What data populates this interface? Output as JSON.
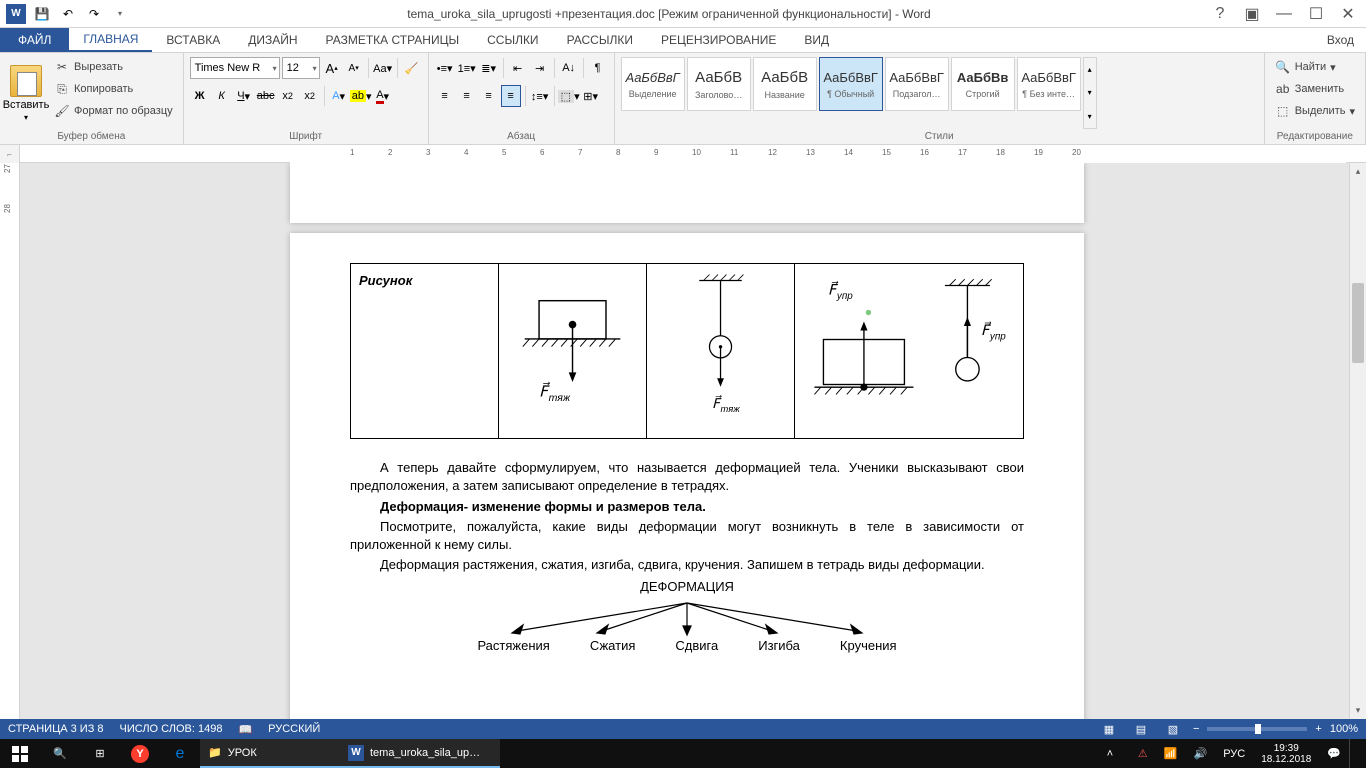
{
  "titlebar": {
    "title": "tema_uroka_sila_uprugosti +презентация.doc [Режим ограниченной функциональности] - Word"
  },
  "tabs": {
    "file": "ФАЙЛ",
    "items": [
      "ГЛАВНАЯ",
      "ВСТАВКА",
      "ДИЗАЙН",
      "РАЗМЕТКА СТРАНИЦЫ",
      "ССЫЛКИ",
      "РАССЫЛКИ",
      "РЕЦЕНЗИРОВАНИЕ",
      "ВИД"
    ],
    "login": "Вход"
  },
  "ribbon": {
    "clipboard": {
      "label": "Буфер обмена",
      "paste": "Вставить",
      "cut": "Вырезать",
      "copy": "Копировать",
      "format": "Формат по образцу"
    },
    "font": {
      "label": "Шрифт",
      "name": "Times New R",
      "size": "12"
    },
    "paragraph": {
      "label": "Абзац"
    },
    "styles": {
      "label": "Стили",
      "items": [
        {
          "preview": "АаБбВвГ",
          "name": "Выделение",
          "italic": true
        },
        {
          "preview": "АаБбВ",
          "name": "Заголово…"
        },
        {
          "preview": "АаБбВ",
          "name": "Название"
        },
        {
          "preview": "АаБбВвГ",
          "name": "¶ Обычный"
        },
        {
          "preview": "АаБбВвГ",
          "name": "Подзагол…"
        },
        {
          "preview": "АаБбВв",
          "name": "Строгий",
          "bold": true
        },
        {
          "preview": "АаБбВвГ",
          "name": "¶ Без инте…"
        }
      ]
    },
    "editing": {
      "label": "Редактирование",
      "find": "Найти",
      "replace": "Заменить",
      "select": "Выделить"
    }
  },
  "ruler": {
    "hticks": [
      "1",
      "2",
      "3",
      "4",
      "5",
      "6",
      "7",
      "8",
      "9",
      "10",
      "11",
      "12",
      "13",
      "14",
      "15",
      "16",
      "17",
      "18",
      "19",
      "20"
    ]
  },
  "vruler": {
    "ticks": [
      "27",
      "28"
    ]
  },
  "document": {
    "figureLabel": "Рисунок",
    "forceGrav": "тяж",
    "forceElastic": "упр",
    "p1": "А теперь давайте сформулируем, что называется деформацией тела. Ученики высказывают свои предположения, а затем записывают определение в тетрадях.",
    "p2": "Деформация- изменение формы и размеров тела.",
    "p3": "Посмотрите, пожалуйста, какие виды деформации могут возникнуть в теле в зависимости от приложенной к нему силы.",
    "p4": "Деформация растяжения, сжатия, изгиба, сдвига, кручения. Запишем в тетрадь виды деформации.",
    "diagramTitle": "ДЕФОРМАЦИЯ",
    "types": [
      "Растяжения",
      "Сжатия",
      "Сдвига",
      "Изгиба",
      "Кручения"
    ]
  },
  "statusbar": {
    "page": "СТРАНИЦА 3 ИЗ 8",
    "words": "ЧИСЛО СЛОВ: 1498",
    "lang": "РУССКИЙ",
    "zoom": "100%"
  },
  "taskbar": {
    "folder": "УРОК",
    "word": "tema_uroka_sila_up…",
    "lang": "РУС",
    "time": "19:39",
    "date": "18.12.2018"
  }
}
